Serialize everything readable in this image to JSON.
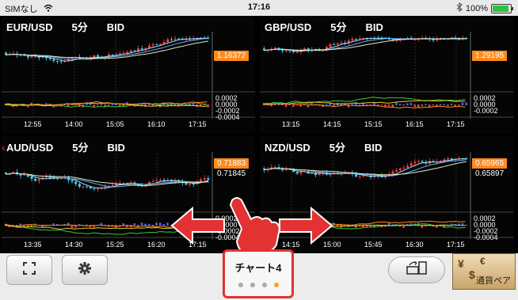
{
  "status_bar": {
    "carrier": "SIMなし",
    "time": "17:16",
    "battery": "100%",
    "battery_level": 1.0
  },
  "panels": [
    {
      "pair": "EUR/USD",
      "interval": "5分",
      "side": "BID",
      "price_tag": "1.16372",
      "price_plain": "",
      "osc_labels": [
        "0.0002",
        "0.0000",
        "-0.0002",
        "-0.0004"
      ],
      "times": [
        "12:55",
        "14:00",
        "15:05",
        "16:10",
        "17:15"
      ]
    },
    {
      "pair": "GBP/USD",
      "interval": "5分",
      "side": "BID",
      "price_tag": "1.29195",
      "price_plain": "",
      "osc_labels": [
        "0.0002",
        "0.0000",
        "-0.0002"
      ],
      "times": [
        "13:15",
        "14:15",
        "15:15",
        "16:15",
        "17:15"
      ]
    },
    {
      "pair": "AUD/USD",
      "interval": "5分",
      "side": "BID",
      "price_tag": "0.71883",
      "price_plain": "0.71845",
      "osc_labels": [
        "0.0002",
        "0.0000",
        "-0.0002",
        "-0.0004"
      ],
      "times": [
        "13:35",
        "14:30",
        "15:25",
        "16:20",
        "17:15"
      ]
    },
    {
      "pair": "NZD/USD",
      "interval": "5分",
      "side": "BID",
      "price_tag": "0.65965",
      "price_plain": "0.65897",
      "osc_labels": [
        "0.0002",
        "0.0000",
        "-0.0002",
        "-0.0004"
      ],
      "times": [
        "14:15",
        "15:00",
        "15:45",
        "16:30",
        "17:15"
      ]
    }
  ],
  "toolbar": {
    "chart_label": "チャート4",
    "page_total": 4,
    "page_active": 4,
    "pair_button_label": "通貨ペア"
  },
  "colors": {
    "accent": "#ff8a1c",
    "highlight": "#e23232",
    "active_dot": "#f2a22b"
  }
}
